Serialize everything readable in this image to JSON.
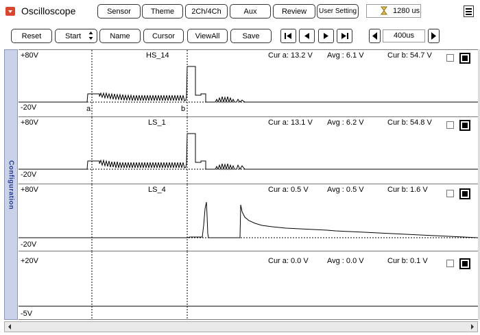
{
  "app": {
    "title": "Oscilloscope",
    "icon": "scope-app-icon"
  },
  "top_buttons": [
    {
      "label": "Sensor"
    },
    {
      "label": "Theme"
    },
    {
      "label": "2Ch/4Ch"
    },
    {
      "label": "Aux"
    },
    {
      "label": "Review"
    },
    {
      "label": "User Setting"
    }
  ],
  "time_display": {
    "value": "1280 us",
    "icon": "hourglass-icon"
  },
  "toolbar2": {
    "reset": "Reset",
    "start": "Start",
    "name": "Name",
    "cursor": "Cursor",
    "viewall": "ViewAll",
    "save": "Save",
    "timebase": "400us"
  },
  "side_tab": "Configuration",
  "channels": [
    {
      "name": "HS_14",
      "max_label": "+80V",
      "min_label": "-20V",
      "cur_a": "Cur a: 13.2 V",
      "avg": "Avg  : 6.1 V",
      "cur_b": "Cur b: 54.7 V"
    },
    {
      "name": "LS_1",
      "max_label": "+80V",
      "min_label": "-20V",
      "cur_a": "Cur a: 13.1 V",
      "avg": "Avg  : 6.2 V",
      "cur_b": "Cur b: 54.8 V"
    },
    {
      "name": "LS_4",
      "max_label": "+80V",
      "min_label": "-20V",
      "cur_a": "Cur a: 0.5 V",
      "avg": "Avg  : 0.5 V",
      "cur_b": "Cur b: 1.6 V"
    },
    {
      "name": "",
      "max_label": "+20V",
      "min_label": "-5V",
      "cur_a": "Cur a: 0.0 V",
      "avg": "Avg  : 0.0 V",
      "cur_b": "Cur b: 0.1 V"
    }
  ],
  "cursors": {
    "a_label": "a",
    "b_label": "b"
  },
  "colors": {
    "side_tab": "#c9d2e8",
    "side_text": "#2a3d8f",
    "app_icon": "#d9462f",
    "trace": "#000000"
  }
}
